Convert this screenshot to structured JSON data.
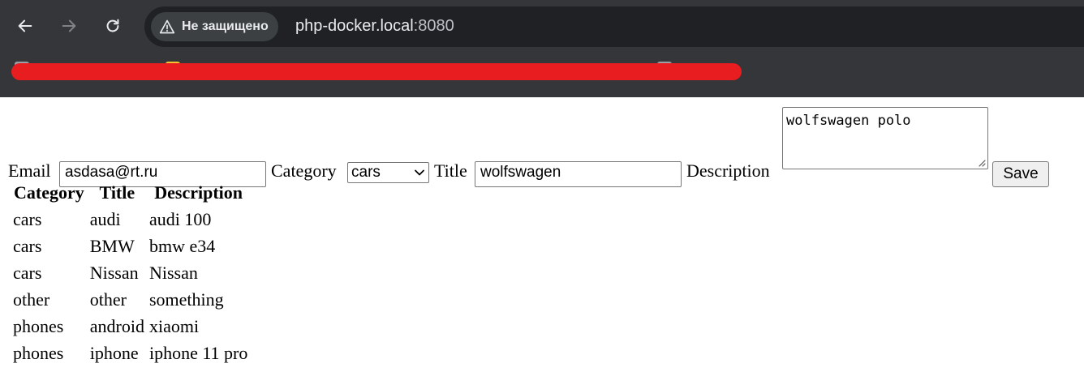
{
  "browser": {
    "security_label": "Не защищено",
    "url_host": "php-docker.local",
    "url_port": ":8080"
  },
  "form": {
    "email_label": "Email",
    "email_value": "asdasa@rt.ru",
    "category_label": "Category",
    "category_selected": "cars",
    "title_label": "Title",
    "title_value": "wolfswagen",
    "description_label": "Description",
    "description_value": "wolfswagen polo",
    "save_label": "Save"
  },
  "table": {
    "headers": [
      "Category",
      "Title",
      "Description"
    ],
    "rows": [
      [
        "cars",
        "audi",
        "audi 100"
      ],
      [
        "cars",
        "BMW",
        "bmw e34"
      ],
      [
        "cars",
        "Nissan",
        "Nissan"
      ],
      [
        "other",
        "other",
        "something"
      ],
      [
        "phones",
        "android",
        "xiaomi"
      ],
      [
        "phones",
        "iphone",
        "iphone 11 pro"
      ]
    ]
  },
  "colors": {
    "chrome_bg": "#35363a",
    "omnibox_bg": "#202124",
    "redaction": "#e71d1f"
  }
}
